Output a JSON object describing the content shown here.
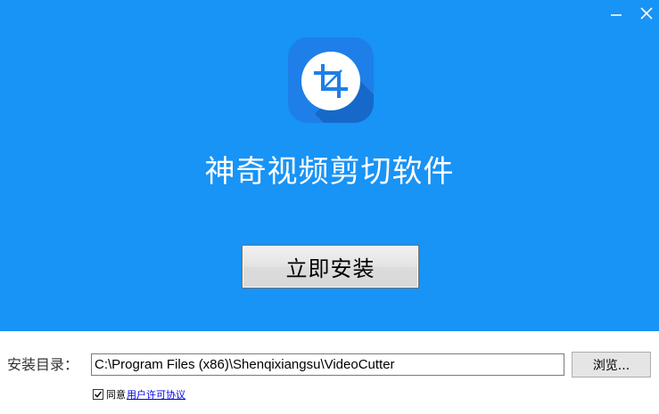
{
  "window": {
    "minimize_icon": "minimize-icon",
    "close_icon": "close-icon"
  },
  "colors": {
    "hero_background": "#1893f6",
    "icon_background": "#1e7fe8",
    "icon_shadow": "#1669c9",
    "link": "#0000ee"
  },
  "app": {
    "icon": "crop-icon",
    "title": "神奇视频剪切软件"
  },
  "install_button": {
    "label": "立即安装"
  },
  "install_dir": {
    "label": "安装目录：",
    "value": "C:\\Program Files (x86)\\Shenqixiangsu\\VideoCutter"
  },
  "browse_button": {
    "label": "浏览..."
  },
  "agreement": {
    "checked": true,
    "label": "同意",
    "link_text": "用户许可协议"
  }
}
